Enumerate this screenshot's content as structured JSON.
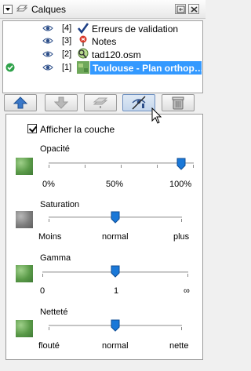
{
  "window": {
    "title": "Calques"
  },
  "layers": [
    {
      "index": "[4]",
      "name": "Erreurs de validation",
      "type_icon": "validation-check-icon",
      "visible": true,
      "active": false,
      "selected": false
    },
    {
      "index": "[3]",
      "name": "Notes",
      "type_icon": "notes-pin-icon",
      "visible": true,
      "active": false,
      "selected": false
    },
    {
      "index": "[2]",
      "name": "tad120.osm",
      "type_icon": "osm-data-icon",
      "visible": true,
      "active": false,
      "selected": false
    },
    {
      "index": "[1]",
      "name": "Toulouse - Plan orthop…",
      "type_icon": "imagery-icon",
      "visible": true,
      "active": true,
      "selected": true
    }
  ],
  "toolbar": {
    "buttons": [
      "move-up",
      "move-down",
      "merge",
      "visibility-settings",
      "delete"
    ]
  },
  "panel": {
    "show_layer_label": "Afficher la couche",
    "show_layer_checked": true,
    "opacity": {
      "title": "Opacité",
      "labels": [
        "0%",
        "50%",
        "100%"
      ],
      "value": 1.0
    },
    "saturation": {
      "title": "Saturation",
      "labels": [
        "Moins",
        "normal",
        "plus"
      ],
      "value": 0.5
    },
    "gamma": {
      "title": "Gamma",
      "labels": [
        "0",
        "1",
        "∞"
      ],
      "value": 0.5
    },
    "sharpness": {
      "title": "Netteté",
      "labels": [
        "flouté",
        "normal",
        "nette"
      ],
      "value": 0.5
    }
  },
  "colors": {
    "selection": "#3399ff",
    "slider_knob": "#1a78d8"
  }
}
